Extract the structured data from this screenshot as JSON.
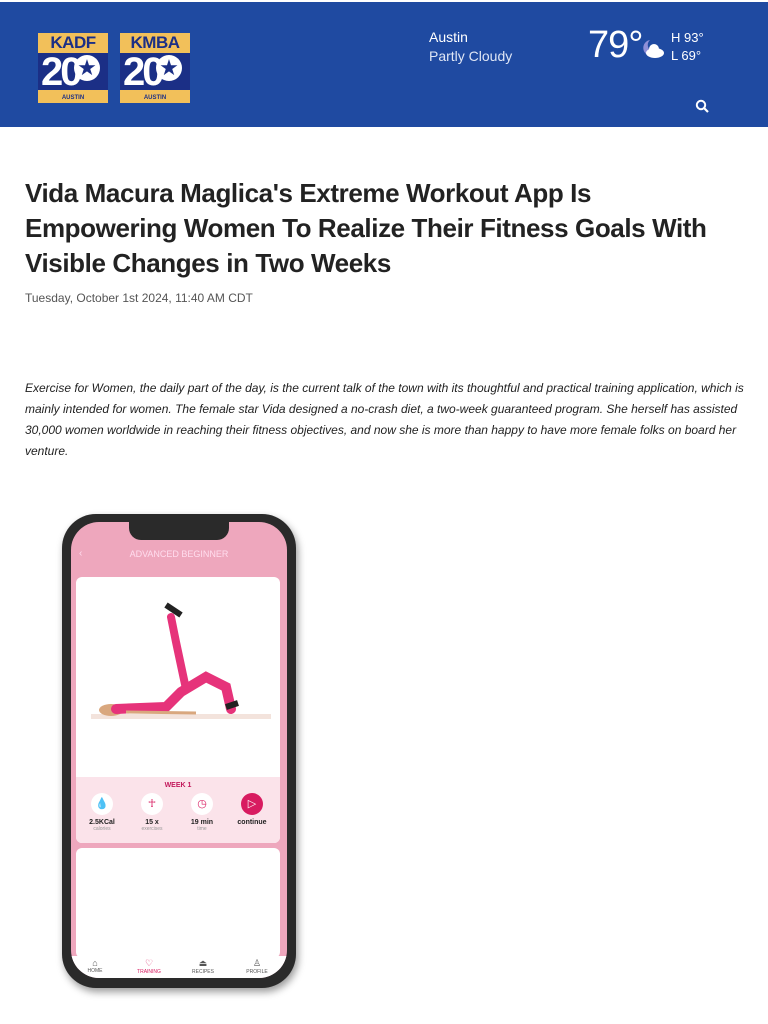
{
  "header": {
    "logos": [
      {
        "call": "KADF",
        "number": "20",
        "city": "AUSTIN"
      },
      {
        "call": "KMBA",
        "number": "20",
        "city": "AUSTIN"
      }
    ],
    "weather": {
      "city": "Austin",
      "condition": "Partly Cloudy",
      "temp": "79°",
      "high": "H 93°",
      "low": "L 69°",
      "icon": "partly-cloudy-night-icon"
    },
    "search_icon": "search-icon",
    "color": "#1f4aa1"
  },
  "article": {
    "title": "Vida Macura Maglica's Extreme Workout App Is Empowering Women To Realize Their Fitness Goals With Visible Changes in Two Weeks",
    "date": "Tuesday, October 1st 2024, 11:40 AM CDT",
    "body": "Exercise for Women, the daily part of the day, is the current talk of the town with its thoughtful and practical training application, which is mainly intended for women. The female star Vida designed a no-crash diet, a two-week guaranteed program. She herself has assisted 30,000 women worldwide in reaching their fitness objectives, and now she is more than happy to have more female folks on board her venture."
  },
  "phone": {
    "screen_title": "ADVANCED BEGINNER",
    "week": "WEEK 1",
    "stats": [
      {
        "value": "2.5KCal",
        "label": "calories",
        "icon": "drop-icon"
      },
      {
        "value": "15 x",
        "label": "exercises",
        "icon": "person-icon"
      },
      {
        "value": "19 min",
        "label": "time",
        "icon": "clock-icon"
      },
      {
        "value": "continue",
        "label": "",
        "icon": "play-icon"
      }
    ],
    "tabs": [
      {
        "label": "HOME"
      },
      {
        "label": "TRAINING"
      },
      {
        "label": "RECIPES"
      },
      {
        "label": "PROFILE"
      }
    ],
    "accent": "#d81b60"
  }
}
